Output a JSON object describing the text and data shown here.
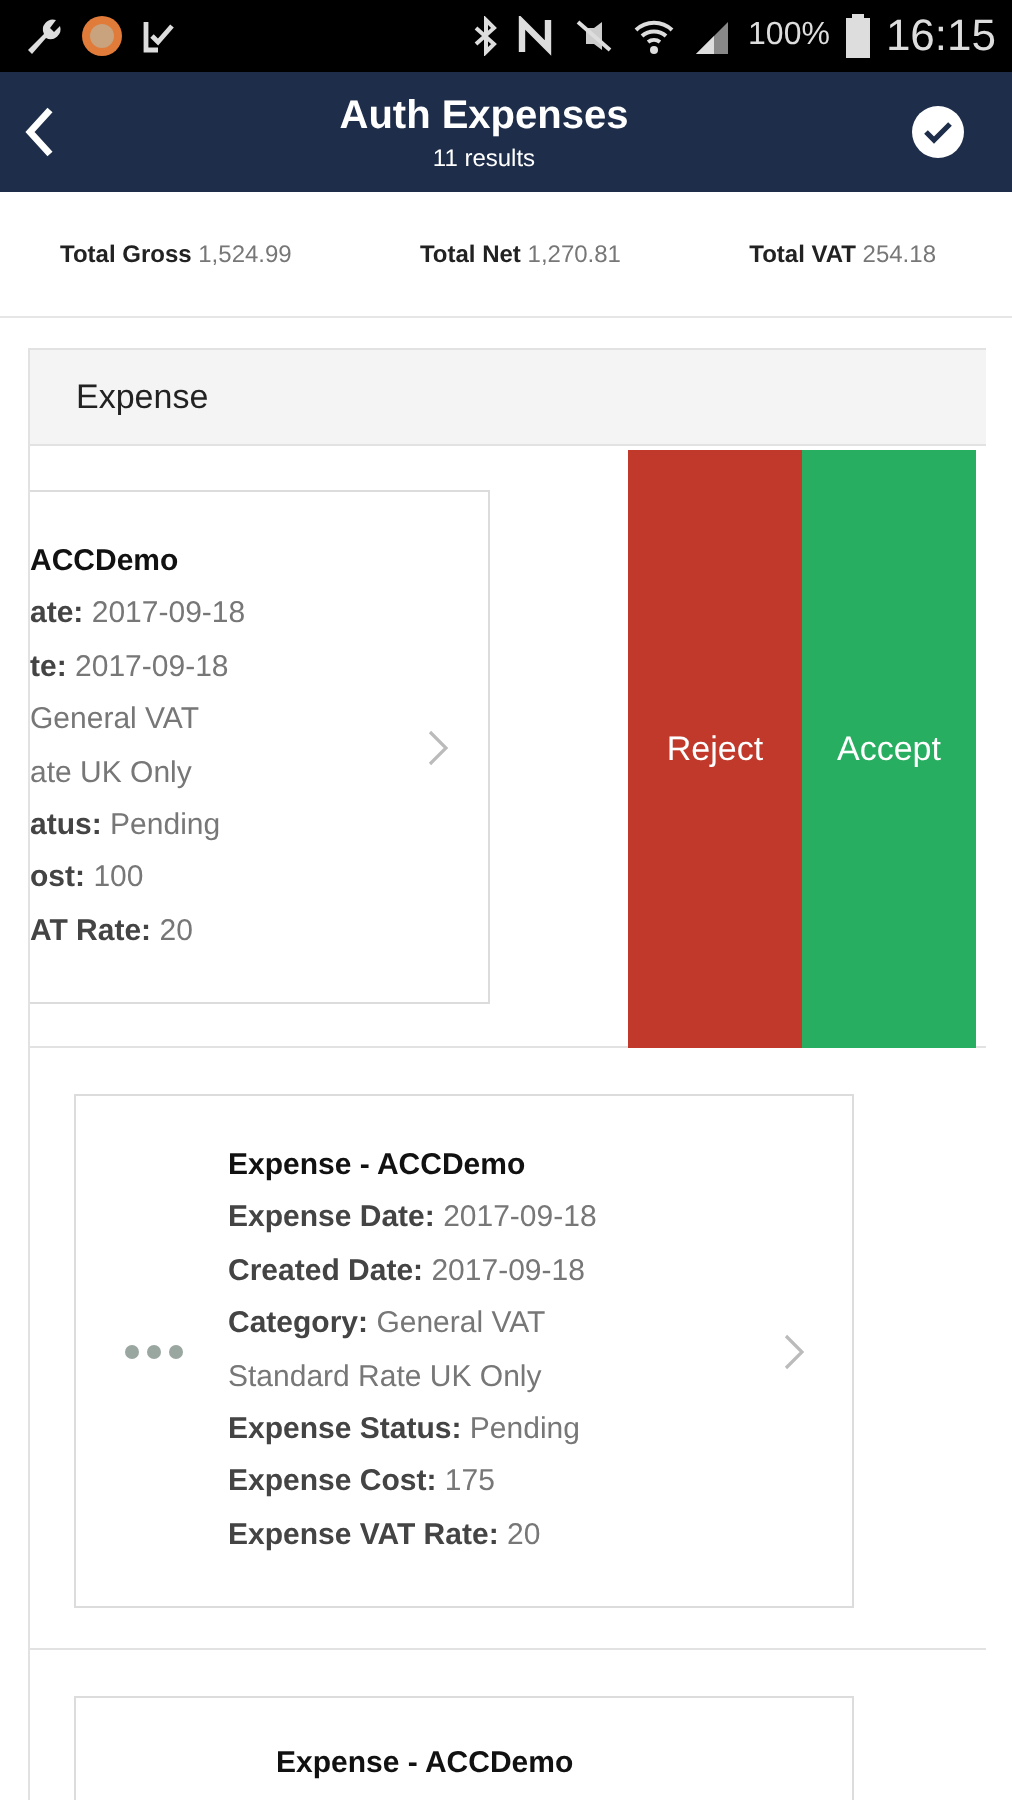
{
  "status_bar": {
    "battery": "100%",
    "time": "16:15"
  },
  "header": {
    "title": "Auth Expenses",
    "subtitle": "11 results"
  },
  "totals": [
    {
      "label": "Total Gross",
      "value": "1,524.99"
    },
    {
      "label": "Total Net",
      "value": "1,270.81"
    },
    {
      "label": "Total VAT",
      "value": "254.18"
    }
  ],
  "section": {
    "title": "Expense"
  },
  "rows": [
    {
      "kind": "swiped",
      "title": "ACCDemo",
      "lines": [
        {
          "label": "ate:",
          "value": "2017-09-18"
        },
        {
          "label": "te:",
          "value": "2017-09-18"
        },
        {
          "value": "General VAT"
        },
        {
          "value": "ate UK Only"
        },
        {
          "label": "atus:",
          "value": "Pending"
        },
        {
          "label": "ost:",
          "value": "100"
        },
        {
          "label": "AT Rate:",
          "value": "20"
        }
      ],
      "actions": [
        {
          "label": "Reject",
          "color": "#c0392b"
        },
        {
          "label": "Accept",
          "color": "#27ae60"
        }
      ]
    },
    {
      "kind": "card",
      "title": "Expense - ACCDemo",
      "lines": [
        {
          "label": "Expense Date:",
          "value": "2017-09-18"
        },
        {
          "label": "Created Date:",
          "value": "2017-09-18"
        },
        {
          "label": "Category:",
          "value": "General VAT"
        },
        {
          "value": "Standard Rate UK Only"
        },
        {
          "label": "Expense Status:",
          "value": "Pending"
        },
        {
          "label": "Expense Cost:",
          "value": "175"
        },
        {
          "label": "Expense VAT Rate:",
          "value": "20"
        }
      ]
    },
    {
      "kind": "card",
      "title": "Expense - ACCDemo",
      "lines": []
    }
  ]
}
